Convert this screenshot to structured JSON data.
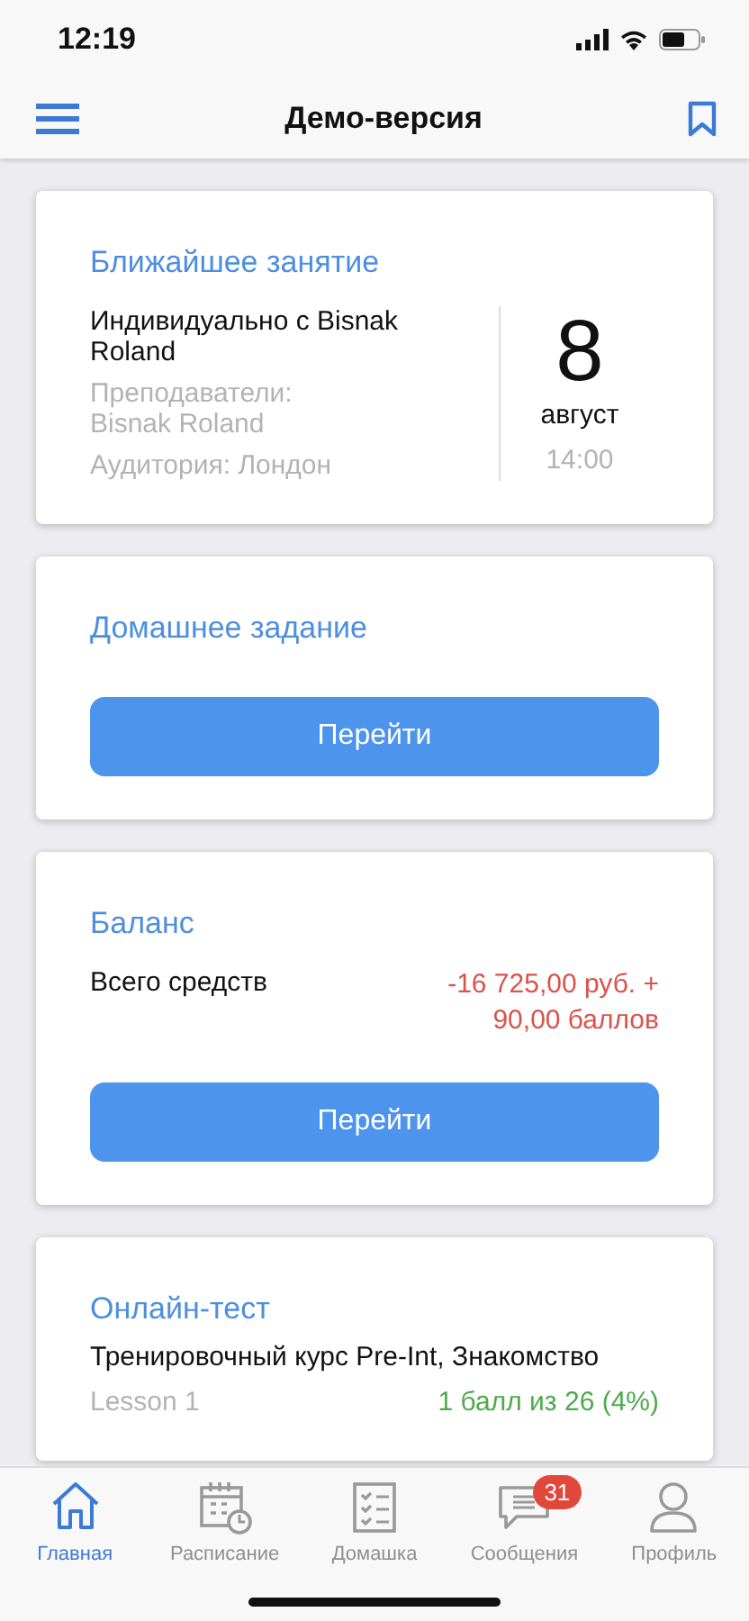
{
  "status_bar": {
    "time": "12:19"
  },
  "nav_bar": {
    "title": "Демо-версия"
  },
  "next_lesson": {
    "title": "Ближайшее занятие",
    "lesson": "Индивидуально с Bisnak Roland",
    "teachers_label": "Преподаватели:",
    "teachers": "Bisnak Roland",
    "room": "Аудитория: Лондон",
    "day": "8",
    "month": "август",
    "time": "14:00"
  },
  "homework": {
    "title": "Домашнее задание",
    "button": "Перейти"
  },
  "balance": {
    "title": "Баланс",
    "label": "Всего средств",
    "amount": "-16 725,00 руб. + 90,00 баллов",
    "button": "Перейти"
  },
  "online_test": {
    "title": "Онлайн-тест",
    "course": "Тренировочный курс Pre-Int, Знакомство",
    "lesson": "Lesson 1",
    "score": "1 балл из 26 (4%)"
  },
  "tab_bar": [
    {
      "label": "Главная",
      "selected": true
    },
    {
      "label": "Расписание",
      "selected": false
    },
    {
      "label": "Домашка",
      "selected": false
    },
    {
      "label": "Сообщения",
      "selected": false,
      "badge": "31"
    },
    {
      "label": "Профиль",
      "selected": false
    }
  ]
}
